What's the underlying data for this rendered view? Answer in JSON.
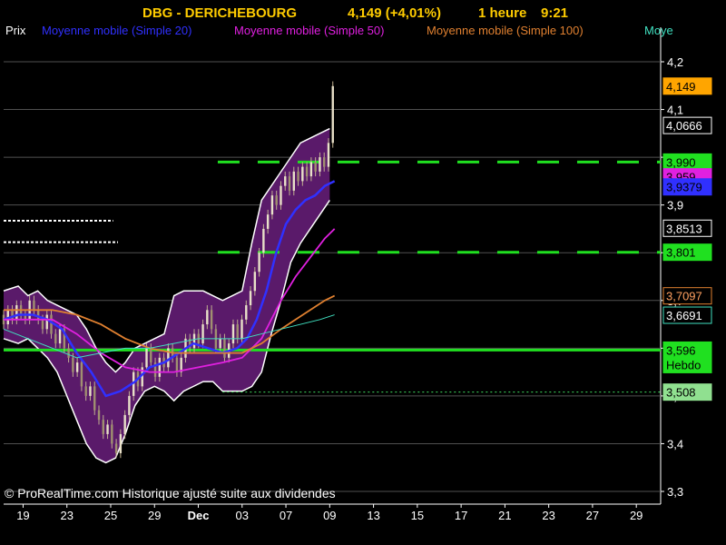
{
  "chart_data": {
    "type": "candlestick",
    "title": {
      "symbol": "DBG - DERICHEBOURG",
      "price": "4,149 (+4,01%)",
      "interval": "1 heure",
      "time": "9:21"
    },
    "legend": [
      {
        "label": "Prix",
        "color": "#ffffff"
      },
      {
        "label": "Moyenne mobile (Simple 20)",
        "color": "#3030ff"
      },
      {
        "label": "Moyenne mobile (Simple 50)",
        "color": "#e020e0"
      },
      {
        "label": "Moyenne mobile (Simple 100)",
        "color": "#e08030"
      },
      {
        "label": "Moye",
        "color": "#40e0c0"
      }
    ],
    "ylim": [
      3.3,
      4.25
    ],
    "y_ticks": [
      "4,2",
      "4,1",
      "4",
      "3,9",
      "3,8",
      "3,7",
      "3,6",
      "3,5",
      "3,4",
      "3,3"
    ],
    "y_tick_values": [
      4.2,
      4.1,
      4.0,
      3.9,
      3.8,
      3.7,
      3.6,
      3.5,
      3.4,
      3.3
    ],
    "x_ticks": [
      "19",
      "23",
      "25",
      "29",
      "Dec",
      "03",
      "07",
      "09",
      "13",
      "15",
      "17",
      "21",
      "23",
      "27",
      "29"
    ],
    "x_tick_index": [
      8,
      26,
      44,
      62,
      80,
      98,
      116,
      134,
      152,
      170,
      188,
      206,
      224,
      242,
      260
    ],
    "x_domain": [
      0,
      270
    ],
    "bollinger_band": {
      "upper": [
        [
          0,
          3.72
        ],
        [
          6,
          3.73
        ],
        [
          10,
          3.71
        ],
        [
          14,
          3.72
        ],
        [
          18,
          3.7
        ],
        [
          22,
          3.69
        ],
        [
          26,
          3.68
        ],
        [
          30,
          3.67
        ],
        [
          34,
          3.64
        ],
        [
          38,
          3.6
        ],
        [
          42,
          3.57
        ],
        [
          46,
          3.55
        ],
        [
          50,
          3.57
        ],
        [
          54,
          3.6
        ],
        [
          58,
          3.61
        ],
        [
          62,
          3.62
        ],
        [
          66,
          3.63
        ],
        [
          70,
          3.71
        ],
        [
          74,
          3.72
        ],
        [
          78,
          3.72
        ],
        [
          82,
          3.72
        ],
        [
          86,
          3.71
        ],
        [
          90,
          3.7
        ],
        [
          94,
          3.71
        ],
        [
          98,
          3.72
        ],
        [
          102,
          3.82
        ],
        [
          106,
          3.91
        ],
        [
          110,
          3.94
        ],
        [
          114,
          3.97
        ],
        [
          118,
          4.0
        ],
        [
          122,
          4.03
        ],
        [
          126,
          4.04
        ],
        [
          130,
          4.05
        ],
        [
          134,
          4.06
        ]
      ],
      "lower": [
        [
          0,
          3.62
        ],
        [
          6,
          3.61
        ],
        [
          10,
          3.62
        ],
        [
          14,
          3.6
        ],
        [
          18,
          3.58
        ],
        [
          22,
          3.55
        ],
        [
          26,
          3.5
        ],
        [
          30,
          3.45
        ],
        [
          34,
          3.4
        ],
        [
          38,
          3.37
        ],
        [
          42,
          3.36
        ],
        [
          46,
          3.37
        ],
        [
          50,
          3.42
        ],
        [
          54,
          3.48
        ],
        [
          58,
          3.51
        ],
        [
          62,
          3.52
        ],
        [
          66,
          3.51
        ],
        [
          70,
          3.49
        ],
        [
          74,
          3.51
        ],
        [
          78,
          3.52
        ],
        [
          82,
          3.53
        ],
        [
          86,
          3.53
        ],
        [
          90,
          3.51
        ],
        [
          94,
          3.51
        ],
        [
          98,
          3.51
        ],
        [
          102,
          3.52
        ],
        [
          106,
          3.55
        ],
        [
          110,
          3.63
        ],
        [
          114,
          3.7
        ],
        [
          118,
          3.78
        ],
        [
          122,
          3.82
        ],
        [
          126,
          3.85
        ],
        [
          130,
          3.88
        ],
        [
          134,
          3.91
        ]
      ]
    },
    "series": [
      {
        "name": "Moyenne mobile (Simple 20)",
        "color": "#3030ff",
        "points": [
          [
            0,
            3.66
          ],
          [
            6,
            3.67
          ],
          [
            12,
            3.67
          ],
          [
            18,
            3.66
          ],
          [
            24,
            3.64
          ],
          [
            30,
            3.59
          ],
          [
            36,
            3.55
          ],
          [
            42,
            3.5
          ],
          [
            48,
            3.51
          ],
          [
            54,
            3.53
          ],
          [
            60,
            3.56
          ],
          [
            66,
            3.57
          ],
          [
            72,
            3.59
          ],
          [
            78,
            3.61
          ],
          [
            84,
            3.6
          ],
          [
            90,
            3.59
          ],
          [
            96,
            3.6
          ],
          [
            100,
            3.62
          ],
          [
            104,
            3.66
          ],
          [
            108,
            3.72
          ],
          [
            112,
            3.8
          ],
          [
            116,
            3.86
          ],
          [
            120,
            3.89
          ],
          [
            124,
            3.91
          ],
          [
            128,
            3.92
          ],
          [
            132,
            3.94
          ],
          [
            136,
            3.95
          ]
        ]
      },
      {
        "name": "Moyenne mobile (Simple 50)",
        "color": "#e020e0",
        "points": [
          [
            0,
            3.66
          ],
          [
            10,
            3.66
          ],
          [
            20,
            3.66
          ],
          [
            30,
            3.63
          ],
          [
            40,
            3.59
          ],
          [
            50,
            3.56
          ],
          [
            60,
            3.55
          ],
          [
            70,
            3.55
          ],
          [
            80,
            3.56
          ],
          [
            90,
            3.57
          ],
          [
            98,
            3.58
          ],
          [
            106,
            3.62
          ],
          [
            114,
            3.7
          ],
          [
            120,
            3.75
          ],
          [
            126,
            3.79
          ],
          [
            132,
            3.83
          ],
          [
            136,
            3.85
          ]
        ]
      },
      {
        "name": "Moyenne mobile (Simple 100)",
        "color": "#e08030",
        "points": [
          [
            0,
            3.68
          ],
          [
            10,
            3.68
          ],
          [
            20,
            3.68
          ],
          [
            30,
            3.67
          ],
          [
            40,
            3.65
          ],
          [
            50,
            3.62
          ],
          [
            60,
            3.6
          ],
          [
            70,
            3.59
          ],
          [
            80,
            3.59
          ],
          [
            90,
            3.59
          ],
          [
            98,
            3.59
          ],
          [
            106,
            3.61
          ],
          [
            114,
            3.64
          ],
          [
            120,
            3.66
          ],
          [
            126,
            3.68
          ],
          [
            132,
            3.7
          ],
          [
            136,
            3.71
          ]
        ]
      },
      {
        "name": "Moye",
        "color": "#40e0c0",
        "points": [
          [
            0,
            3.64
          ],
          [
            10,
            3.62
          ],
          [
            20,
            3.6
          ],
          [
            30,
            3.58
          ],
          [
            40,
            3.59
          ],
          [
            50,
            3.6
          ],
          [
            60,
            3.6
          ],
          [
            70,
            3.61
          ],
          [
            80,
            3.62
          ],
          [
            90,
            3.62
          ],
          [
            98,
            3.62
          ],
          [
            106,
            3.63
          ],
          [
            114,
            3.64
          ],
          [
            122,
            3.65
          ],
          [
            130,
            3.66
          ],
          [
            136,
            3.67
          ]
        ]
      }
    ],
    "candles": [
      [
        3.67,
        3.65
      ],
      [
        3.65,
        3.68
      ],
      [
        3.68,
        3.66
      ],
      [
        3.66,
        3.69
      ],
      [
        3.69,
        3.67
      ],
      [
        3.67,
        3.66
      ],
      [
        3.66,
        3.7
      ],
      [
        3.7,
        3.68
      ],
      [
        3.68,
        3.66
      ],
      [
        3.66,
        3.64
      ],
      [
        3.64,
        3.67
      ],
      [
        3.67,
        3.63
      ],
      [
        3.63,
        3.61
      ],
      [
        3.61,
        3.64
      ],
      [
        3.64,
        3.6
      ],
      [
        3.6,
        3.58
      ],
      [
        3.58,
        3.55
      ],
      [
        3.55,
        3.57
      ],
      [
        3.57,
        3.52
      ],
      [
        3.52,
        3.5
      ],
      [
        3.5,
        3.52
      ],
      [
        3.52,
        3.47
      ],
      [
        3.47,
        3.45
      ],
      [
        3.45,
        3.42
      ],
      [
        3.42,
        3.44
      ],
      [
        3.44,
        3.4
      ],
      [
        3.4,
        3.38
      ],
      [
        3.38,
        3.42
      ],
      [
        3.42,
        3.46
      ],
      [
        3.46,
        3.5
      ],
      [
        3.5,
        3.55
      ],
      [
        3.55,
        3.52
      ],
      [
        3.52,
        3.56
      ],
      [
        3.56,
        3.6
      ],
      [
        3.6,
        3.57
      ],
      [
        3.57,
        3.54
      ],
      [
        3.54,
        3.58
      ],
      [
        3.58,
        3.56
      ],
      [
        3.56,
        3.6
      ],
      [
        3.6,
        3.58
      ],
      [
        3.58,
        3.55
      ],
      [
        3.55,
        3.58
      ],
      [
        3.58,
        3.62
      ],
      [
        3.62,
        3.6
      ],
      [
        3.6,
        3.63
      ],
      [
        3.63,
        3.61
      ],
      [
        3.61,
        3.65
      ],
      [
        3.65,
        3.68
      ],
      [
        3.68,
        3.64
      ],
      [
        3.64,
        3.6
      ],
      [
        3.6,
        3.62
      ],
      [
        3.62,
        3.58
      ],
      [
        3.58,
        3.61
      ],
      [
        3.61,
        3.65
      ],
      [
        3.65,
        3.62
      ],
      [
        3.62,
        3.66
      ],
      [
        3.66,
        3.69
      ],
      [
        3.69,
        3.72
      ],
      [
        3.72,
        3.76
      ],
      [
        3.76,
        3.8
      ],
      [
        3.8,
        3.85
      ],
      [
        3.85,
        3.88
      ],
      [
        3.88,
        3.92
      ],
      [
        3.92,
        3.9
      ],
      [
        3.9,
        3.94
      ],
      [
        3.94,
        3.96
      ],
      [
        3.96,
        3.93
      ],
      [
        3.93,
        3.97
      ],
      [
        3.97,
        3.95
      ],
      [
        3.95,
        3.98
      ],
      [
        3.98,
        3.96
      ],
      [
        3.96,
        3.99
      ],
      [
        3.99,
        3.97
      ],
      [
        3.97,
        4.0
      ],
      [
        4.0,
        3.98
      ],
      [
        3.98,
        4.03
      ],
      [
        4.03,
        4.149
      ]
    ],
    "candles_x_start": 0,
    "candles_x_step": 1.78,
    "horizontal_lines": [
      {
        "value": 3.99,
        "color": "#20e020",
        "style": "dashed",
        "from_index": 88,
        "width": 3
      },
      {
        "value": 3.801,
        "color": "#20e020",
        "style": "dashed",
        "from_index": 88,
        "width": 3
      },
      {
        "value": 3.596,
        "color": "#20e020",
        "style": "solid",
        "from_index": 0,
        "width": 3
      },
      {
        "value": 3.508,
        "color": "#40e060",
        "style": "dotted",
        "from_index": 90,
        "width": 1
      },
      {
        "value": 3.867,
        "color": "#ffffff",
        "style": "dotted",
        "from_index": 0,
        "to_index": 45,
        "width": 2
      },
      {
        "value": 3.822,
        "color": "#ffffff",
        "style": "dotted",
        "from_index": 0,
        "to_index": 47,
        "width": 2
      }
    ],
    "price_badges": [
      {
        "value": 4.149,
        "label": "4,149",
        "bg": "#ffa500",
        "fg": "#000000",
        "border": "#ffa500"
      },
      {
        "value": 4.0666,
        "label": "4,0666",
        "bg": "#000000",
        "fg": "#ffffff",
        "border": "#ffffff"
      },
      {
        "value": 3.99,
        "label": "3,990",
        "bg": "#20e020",
        "fg": "#000000",
        "border": "#20e020"
      },
      {
        "value": 3.959,
        "label": "3,959",
        "bg": "#e020e0",
        "fg": "#000000",
        "border": "#e020e0"
      },
      {
        "value": 3.9379,
        "label": "3,9379",
        "bg": "#3030ff",
        "fg": "#000000",
        "border": "#3030ff"
      },
      {
        "value": 3.8513,
        "label": "3,8513",
        "bg": "#000000",
        "fg": "#ffffff",
        "border": "#ffffff"
      },
      {
        "value": 3.801,
        "label": "3,801",
        "bg": "#20e020",
        "fg": "#000000",
        "border": "#20e020"
      },
      {
        "value": 3.7097,
        "label": "3,7097",
        "bg": "#000000",
        "fg": "#ffa060",
        "border": "#e08030"
      },
      {
        "value": 3.6691,
        "label": "3,6691",
        "bg": "#000000",
        "fg": "#ffffff",
        "border": "#40e0c0"
      },
      {
        "value": 3.596,
        "label": "3,596",
        "bg": "#20e020",
        "fg": "#000000",
        "border": "#20e020",
        "sub": "Hebdo"
      },
      {
        "value": 3.508,
        "label": "3,508",
        "bg": "#90e090",
        "fg": "#000000",
        "border": "#90e090"
      }
    ],
    "footer": "© ProRealTime.com Historique ajusté suite aux dividendes",
    "colors": {
      "background": "#000000",
      "band_fill": "#5a1a6a",
      "band_edge": "#ffffff",
      "grid": "#505050",
      "title": "#ffcc00",
      "axis_text": "#ffffff",
      "x_text": "#ffcc00"
    }
  }
}
